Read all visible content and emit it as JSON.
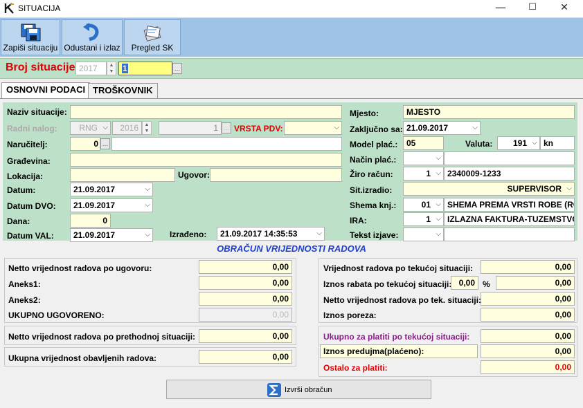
{
  "window": {
    "title": "SITUACIJA",
    "app_icon": "k-logo-icon",
    "minimize": "—",
    "maximize": "☐",
    "close": "✕"
  },
  "toolbar": {
    "save_label": "Zapiši situaciju",
    "cancel_label": "Odustani i izlaz",
    "preview_label": "Pregled SK"
  },
  "broj": {
    "label": "Broj situacije:",
    "year": "2017",
    "number": "1"
  },
  "tabs": {
    "osnovni": "OSNOVNI PODACI",
    "troskovnik": "TROŠKOVNIK"
  },
  "left": {
    "naziv_label": "Naziv situacije:",
    "naziv_value": "",
    "radni_label": "Radni nalog:",
    "radni_type": "RNG",
    "radni_year": "2016",
    "radni_number": "1",
    "vrsta_pdv_label": "VRSTA PDV:",
    "vrsta_pdv_value": "",
    "narucitelj_label": "Naručitelj:",
    "narucitelj_code": "0",
    "narucitelj_name": "",
    "gradevina_label": "Građevina:",
    "gradevina_value": "",
    "lokacija_label": "Lokacija:",
    "lokacija_value": "",
    "ugovor_label": "Ugovor:",
    "ugovor_value": "",
    "datum_label": "Datum:",
    "datum_value": "21.09.2017",
    "datum_dvo_label": "Datum DVO:",
    "datum_dvo_value": "21.09.2017",
    "dana_label": "Dana:",
    "dana_value": "0",
    "datum_val_label": "Datum VAL:",
    "datum_val_value": "21.09.2017",
    "izradeno_label": "Izrađeno:",
    "izradeno_value": "21.09.2017 14:35:53"
  },
  "right": {
    "mjesto_label": "Mjesto:",
    "mjesto_value": "MJESTO",
    "zakljucno_label": "Zaključno sa:",
    "zakljucno_value": "21.09.2017",
    "model_label": "Model plać.:",
    "model_value": "05",
    "valuta_label": "Valuta:",
    "valuta_value": "191",
    "valuta_unit": "kn",
    "nacin_label": "Način plać.:",
    "nacin_value": "",
    "nacin_desc": "",
    "ziro_label": "Žiro račun:",
    "ziro_code": "1",
    "ziro_value": "2340009-1233",
    "sit_izradio_label": "Sit.izradio:",
    "sit_izradio_value": "SUPERVISOR",
    "shema_label": "Shema knj.:",
    "shema_code": "01",
    "shema_value": "SHEMA PREMA VRSTI ROBE (RO",
    "ira_label": "IRA:",
    "ira_code": "1",
    "ira_value": "IZLAZNA FAKTURA-TUZEMSTVO",
    "tekst_label": "Tekst izjave:",
    "tekst_value": "",
    "tekst_desc": ""
  },
  "obracun": {
    "title": "OBRAČUN VRIJEDNOSTI RADOVA",
    "netto_ugovor_label": "Netto vrijednost radova po ugovoru:",
    "netto_ugovor": "0,00",
    "aneks1_label": "Aneks1:",
    "aneks1": "0,00",
    "aneks2_label": "Aneks2:",
    "aneks2": "0,00",
    "ukupno_ugovoreno_label": "UKUPNO UGOVORENO:",
    "ukupno_ugovoreno": "0,00",
    "netto_prethodna_label": "Netto vrijednost radova po prethodnoj situaciji:",
    "netto_prethodna": "0,00",
    "ukupna_obavljenih_label": "Ukupna vrijednost obavljenih radova:",
    "ukupna_obavljenih": "0,00",
    "vrijednost_tekuca_label": "Vrijednost radova po tekućoj situaciji:",
    "vrijednost_tekuca": "0,00",
    "rabat_label": "Iznos rabata po tekućoj situaciji:",
    "rabat_pct": "0,00",
    "pct_sign": "%",
    "rabat": "0,00",
    "netto_tekuca_label": "Netto vrijednost radova po tek. situaciji:",
    "netto_tekuca": "0,00",
    "porez_label": "Iznos poreza:",
    "porez": "0,00",
    "ukupno_platiti_label": "Ukupno za platiti po tekućoj situaciji:",
    "ukupno_platiti": "0,00",
    "predujam_label": "Iznos predujma(plaćeno):",
    "predujam": "0,00",
    "ostalo_label": "Ostalo za platiti:",
    "ostalo": "0,00"
  },
  "izvrsi_label": "Izvrši obračun"
}
